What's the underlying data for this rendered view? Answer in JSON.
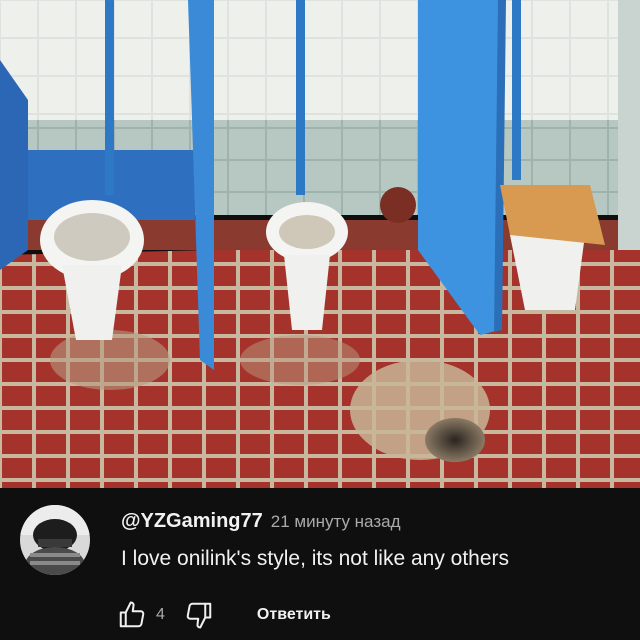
{
  "comment": {
    "author": "@YZGaming77",
    "time": "21 минуту назад",
    "text": "I love onilink's style, its not like any others",
    "like_count": "4",
    "reply_label": "Ответить"
  },
  "icons": {
    "like": "thumb-up-outline-icon",
    "dislike": "thumb-down-outline-icon"
  },
  "colors": {
    "background": "#0f0f0f",
    "text_primary": "#f1f1f1",
    "text_secondary": "#aaaaaa"
  }
}
